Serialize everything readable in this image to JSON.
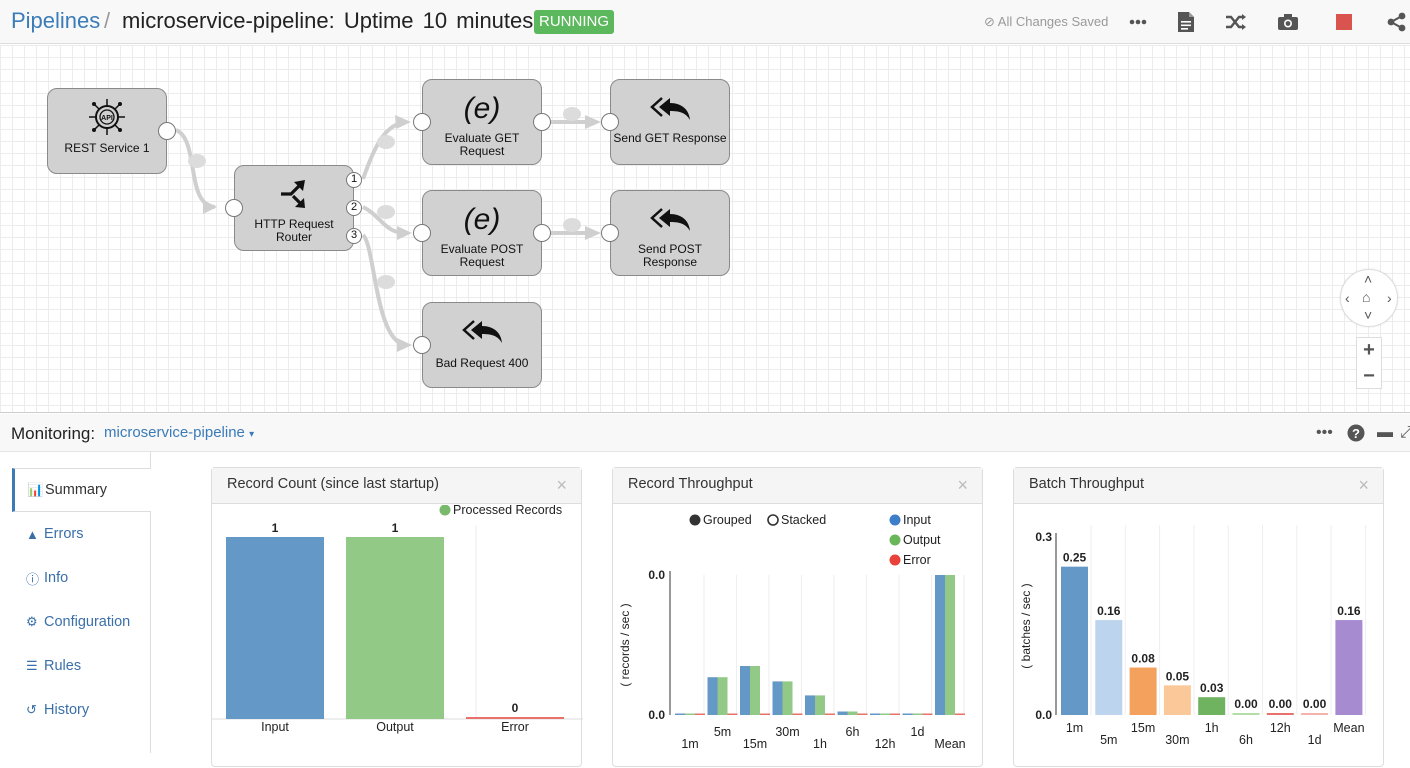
{
  "header": {
    "breadcrumb_root": "Pipelines",
    "separator": "/",
    "title": "microservice-pipeline:  Uptime  10 minutes",
    "status_badge": "RUNNING",
    "save_status": "All Changes Saved",
    "icons": [
      "more-icon",
      "document-icon",
      "shuffle-icon",
      "camera-icon",
      "stop-icon",
      "share-icon"
    ],
    "colors": {
      "link": "#3a7bb8",
      "running": "#5cb85c",
      "stop": "#d9534f"
    }
  },
  "pipeline": {
    "nodes": [
      {
        "id": "rest",
        "label": "REST Service 1",
        "icon": "api-icon"
      },
      {
        "id": "router",
        "label": "HTTP Request Router",
        "icon": "router-icon",
        "outputs": [
          "1",
          "2",
          "3"
        ]
      },
      {
        "id": "evalget",
        "label": "Evaluate GET Request",
        "icon": "expression-icon"
      },
      {
        "id": "evalpost",
        "label": "Evaluate POST Request",
        "icon": "expression-icon"
      },
      {
        "id": "bad",
        "label": "Bad Request 400",
        "icon": "reply-all-icon"
      },
      {
        "id": "sendget",
        "label": "Send GET Response",
        "icon": "reply-all-icon"
      },
      {
        "id": "sendpost",
        "label": "Send POST Response",
        "icon": "reply-all-icon"
      }
    ]
  },
  "monitoring": {
    "label": "Monitoring:",
    "pipeline_select": "microservice-pipeline"
  },
  "sidebar": {
    "items": [
      {
        "label": "Summary",
        "icon": "bar-chart-icon",
        "active": true
      },
      {
        "label": "Errors",
        "icon": "warning-icon"
      },
      {
        "label": "Info",
        "icon": "info-icon"
      },
      {
        "label": "Configuration",
        "icon": "gear-icon"
      },
      {
        "label": "Rules",
        "icon": "list-icon"
      },
      {
        "label": "History",
        "icon": "history-icon"
      }
    ]
  },
  "panels": {
    "record_count_title": "Record Count (since last startup)",
    "record_throughput_title": "Record Throughput",
    "batch_throughput_title": "Batch Throughput",
    "close": "×"
  },
  "chart_data": [
    {
      "type": "bar",
      "title": "Record Count (since last startup)",
      "categories": [
        "Input",
        "Output",
        "Error"
      ],
      "values": [
        1,
        1,
        0
      ],
      "colors": [
        "#6498c7",
        "#92c987",
        "#e8726a"
      ],
      "legend": [
        "Processed Records"
      ],
      "legend_color": "#78b96b",
      "legend_position": "top-right",
      "ylim": [
        0,
        1
      ]
    },
    {
      "type": "bar",
      "title": "Record Throughput",
      "mode_options": [
        "Grouped",
        "Stacked"
      ],
      "mode_selected": "Grouped",
      "categories": [
        "1m",
        "5m",
        "15m",
        "30m",
        "1h",
        "6h",
        "12h",
        "1d",
        "Mean"
      ],
      "series": [
        {
          "name": "Input",
          "color": "#6498c7",
          "values": [
            0.0,
            0.27,
            0.35,
            0.24,
            0.14,
            0.025,
            0.008,
            0.004,
            1.0
          ]
        },
        {
          "name": "Output",
          "color": "#92c987",
          "values": [
            0.0,
            0.27,
            0.35,
            0.24,
            0.14,
            0.025,
            0.008,
            0.004,
            1.0
          ]
        },
        {
          "name": "Error",
          "color": "#e8726a",
          "values": [
            0,
            0,
            0,
            0,
            0,
            0,
            0,
            0,
            0
          ]
        }
      ],
      "legend_dot_colors": [
        "#3d7dca",
        "#6ab65a",
        "#e8423a"
      ],
      "yticks": [
        "0.0",
        "0.0"
      ],
      "ylabel": "( records / sec )",
      "legend_position": "top-right"
    },
    {
      "type": "bar",
      "title": "Batch Throughput",
      "categories": [
        "1m",
        "5m",
        "15m",
        "30m",
        "1h",
        "6h",
        "12h",
        "1d",
        "Mean"
      ],
      "values": [
        0.25,
        0.16,
        0.08,
        0.05,
        0.03,
        0.0,
        0.0,
        0.0,
        0.16
      ],
      "labels": [
        "0.25",
        "0.16",
        "0.08",
        "0.05",
        "0.03",
        "0.00",
        "0.00",
        "0.00",
        "0.16"
      ],
      "colors": [
        "#6498c7",
        "#bdd4ee",
        "#f5a15e",
        "#fbc999",
        "#6fb360",
        "#b3dea7",
        "#e8726a",
        "#f5b3ae",
        "#a78bd0"
      ],
      "yticks": [
        "0.0",
        "0.3"
      ],
      "ylim": [
        0,
        0.3
      ],
      "ylabel": "( batches / sec )"
    }
  ]
}
